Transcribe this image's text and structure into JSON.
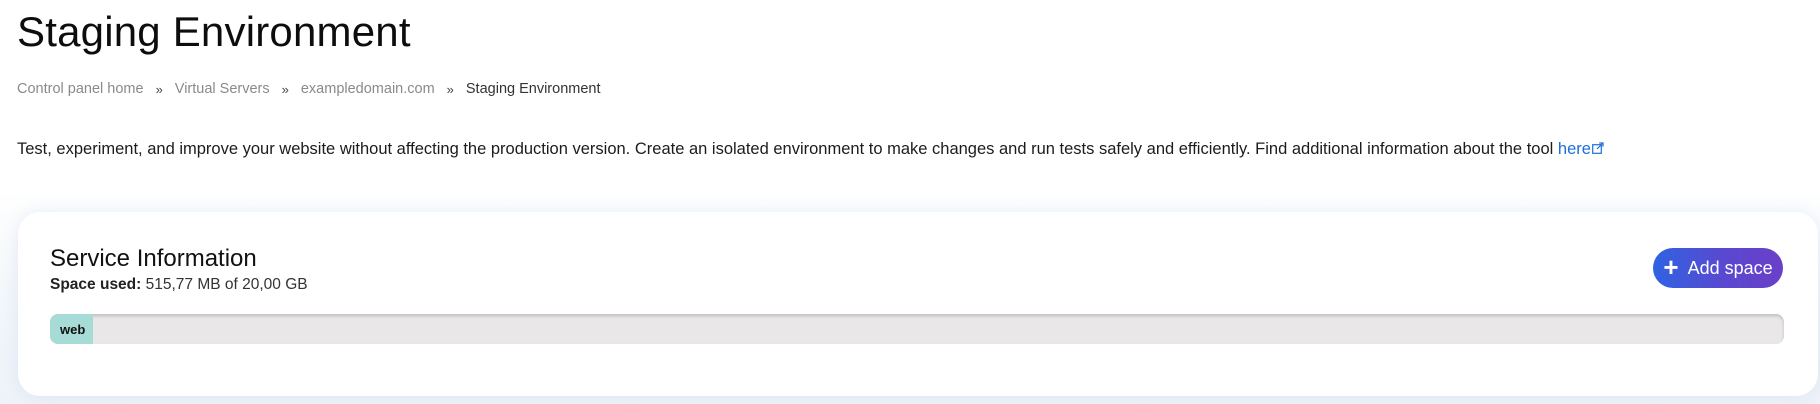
{
  "page": {
    "title": "Staging Environment"
  },
  "breadcrumb": {
    "items": [
      {
        "label": "Control panel home"
      },
      {
        "label": "Virtual Servers"
      },
      {
        "label": "exampledomain.com"
      },
      {
        "label": "Staging Environment"
      }
    ],
    "separator": "»"
  },
  "intro": {
    "text": "Test, experiment, and improve your website without affecting the production version. Create an isolated environment to make changes and run tests safely and efficiently. Find additional information about the tool ",
    "link_label": "here",
    "link_icon": "external-link-icon"
  },
  "service": {
    "title": "Service Information",
    "space_used_label": "Space used:",
    "space_used_value": "515,77 MB of 20,00 GB",
    "add_button_icon": "plus-icon",
    "add_button_label": "Add space",
    "usage_bar": {
      "segment_label": "web",
      "segment_fraction": 0.025,
      "segment_color": "#a7dbd6",
      "track_color": "#eae7e8"
    }
  },
  "colors": {
    "accent_link": "#1e6fd9",
    "button_gradient_start": "#2f63e2",
    "button_gradient_end": "#6a3fc8"
  }
}
